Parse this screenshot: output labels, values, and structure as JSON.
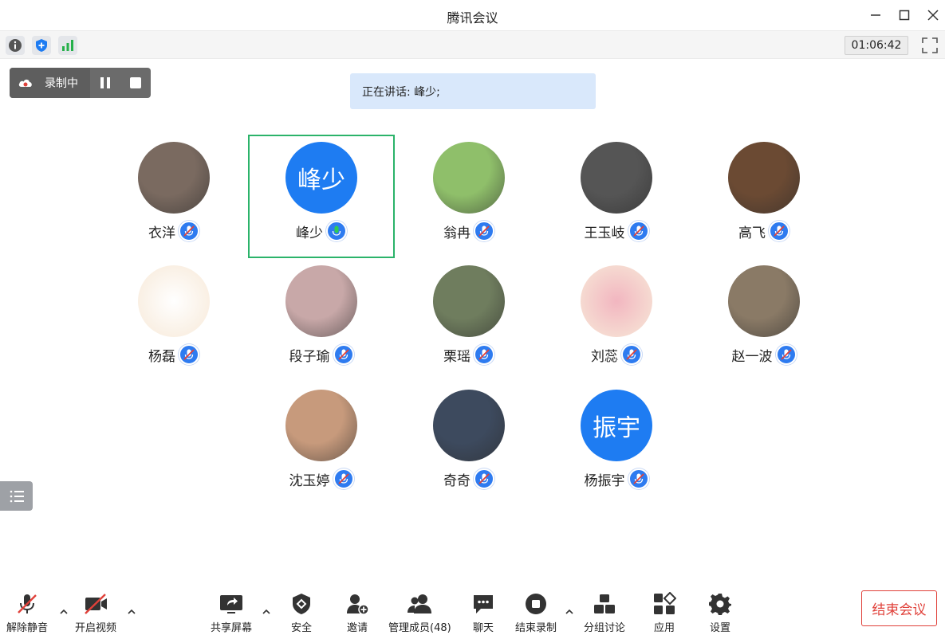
{
  "window": {
    "title": "腾讯会议"
  },
  "statusbar": {
    "timer": "01:06:42"
  },
  "recording": {
    "label": "录制中"
  },
  "speaking": {
    "text": "正在讲话: 峰少;"
  },
  "participants": [
    {
      "name": "衣洋",
      "avatar": "photo",
      "avatar_color": "#7a6a60"
    },
    {
      "name": "峰少",
      "avatar": "text",
      "avatar_text": "峰少",
      "active": true
    },
    {
      "name": "翁冉",
      "avatar": "photo",
      "avatar_color": "#8fbf6a"
    },
    {
      "name": "王玉岐",
      "avatar": "photo",
      "avatar_color": "#555555"
    },
    {
      "name": "高飞",
      "avatar": "photo",
      "avatar_color": "#6b4a33"
    },
    {
      "name": "杨磊",
      "avatar": "cartoon",
      "avatar_color": "#ffffff"
    },
    {
      "name": "段子瑜",
      "avatar": "photo",
      "avatar_color": "#c8a8a8"
    },
    {
      "name": "栗瑶",
      "avatar": "photo",
      "avatar_color": "#6f7d5e"
    },
    {
      "name": "刘蕊",
      "avatar": "cartoon",
      "avatar_color": "#f2b6c0"
    },
    {
      "name": "赵一波",
      "avatar": "photo",
      "avatar_color": "#8a7a66"
    },
    {
      "name": "沈玉婷",
      "avatar": "photo",
      "avatar_color": "#c79a7c"
    },
    {
      "name": "奇奇",
      "avatar": "photo",
      "avatar_color": "#3d4a5e"
    },
    {
      "name": "杨振宇",
      "avatar": "text",
      "avatar_text": "振宇"
    }
  ],
  "toolbar": {
    "unmute": "解除静音",
    "video": "开启视频",
    "share": "共享屏幕",
    "security": "安全",
    "invite": "邀请",
    "members": "管理成员(48)",
    "chat": "聊天",
    "end_record": "结束录制",
    "breakout": "分组讨论",
    "apps": "应用",
    "settings": "设置",
    "end_meeting": "结束会议"
  },
  "colors": {
    "accent": "#1e7cf2",
    "active_border": "#2bb36a",
    "danger": "#e0413a"
  }
}
